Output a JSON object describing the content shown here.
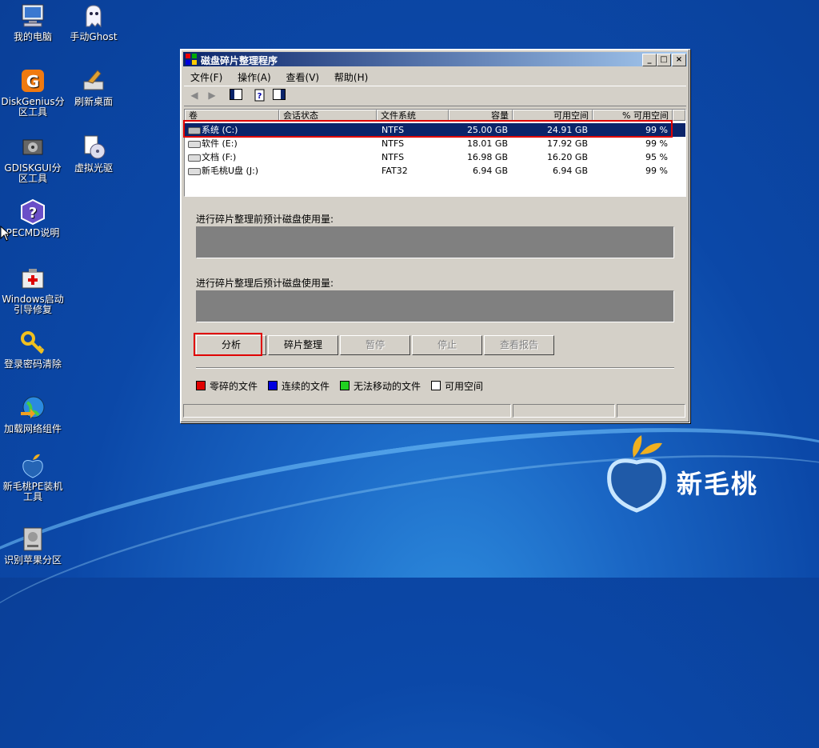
{
  "desktop": {
    "icons": [
      {
        "label": "我的电脑"
      },
      {
        "label": "手动Ghost"
      },
      {
        "label": "DiskGenius分区工具"
      },
      {
        "label": "刷新桌面"
      },
      {
        "label": "GDISKGUI分区工具"
      },
      {
        "label": "虚拟光驱"
      },
      {
        "label": "PECMD说明"
      },
      {
        "label": "Windows启动引导修复"
      },
      {
        "label": "登录密码清除"
      },
      {
        "label": "加载网络组件"
      },
      {
        "label": "新毛桃PE装机工具"
      },
      {
        "label": "识别苹果分区"
      }
    ],
    "brand": "新毛桃"
  },
  "window": {
    "title": "磁盘碎片整理程序",
    "controls": {
      "minimize": "0",
      "maximize": "1",
      "close": "r"
    },
    "menu": [
      "文件(F)",
      "操作(A)",
      "查看(V)",
      "帮助(H)"
    ],
    "columns": [
      "卷",
      "会话状态",
      "文件系统",
      "容量",
      "可用空间",
      "% 可用空间"
    ],
    "volumes": [
      {
        "name": "系统 (C:)",
        "status": "",
        "fs": "NTFS",
        "capacity": "25.00 GB",
        "free": "24.91 GB",
        "pct": "99 %"
      },
      {
        "name": "软件 (E:)",
        "status": "",
        "fs": "NTFS",
        "capacity": "18.01 GB",
        "free": "17.92 GB",
        "pct": "99 %"
      },
      {
        "name": "文档 (F:)",
        "status": "",
        "fs": "NTFS",
        "capacity": "16.98 GB",
        "free": "16.20 GB",
        "pct": "95 %"
      },
      {
        "name": "新毛桃U盘 (J:)",
        "status": "",
        "fs": "FAT32",
        "capacity": "6.94 GB",
        "free": "6.94 GB",
        "pct": "99 %"
      }
    ],
    "before_label": "进行碎片整理前预计磁盘使用量:",
    "after_label": "进行碎片整理后预计磁盘使用量:",
    "buttons": [
      "分析",
      "碎片整理",
      "暂停",
      "停止",
      "查看报告"
    ],
    "legend": [
      {
        "label": "零碎的文件",
        "color": "#e00000"
      },
      {
        "label": "连续的文件",
        "color": "#0000e0"
      },
      {
        "label": "无法移动的文件",
        "color": "#20d020"
      },
      {
        "label": "可用空间",
        "color": "#ffffff"
      }
    ],
    "colors": {
      "titlebar_start": "#0a246a",
      "titlebar_end": "#a6caf0",
      "highlight": "#e00000"
    }
  }
}
